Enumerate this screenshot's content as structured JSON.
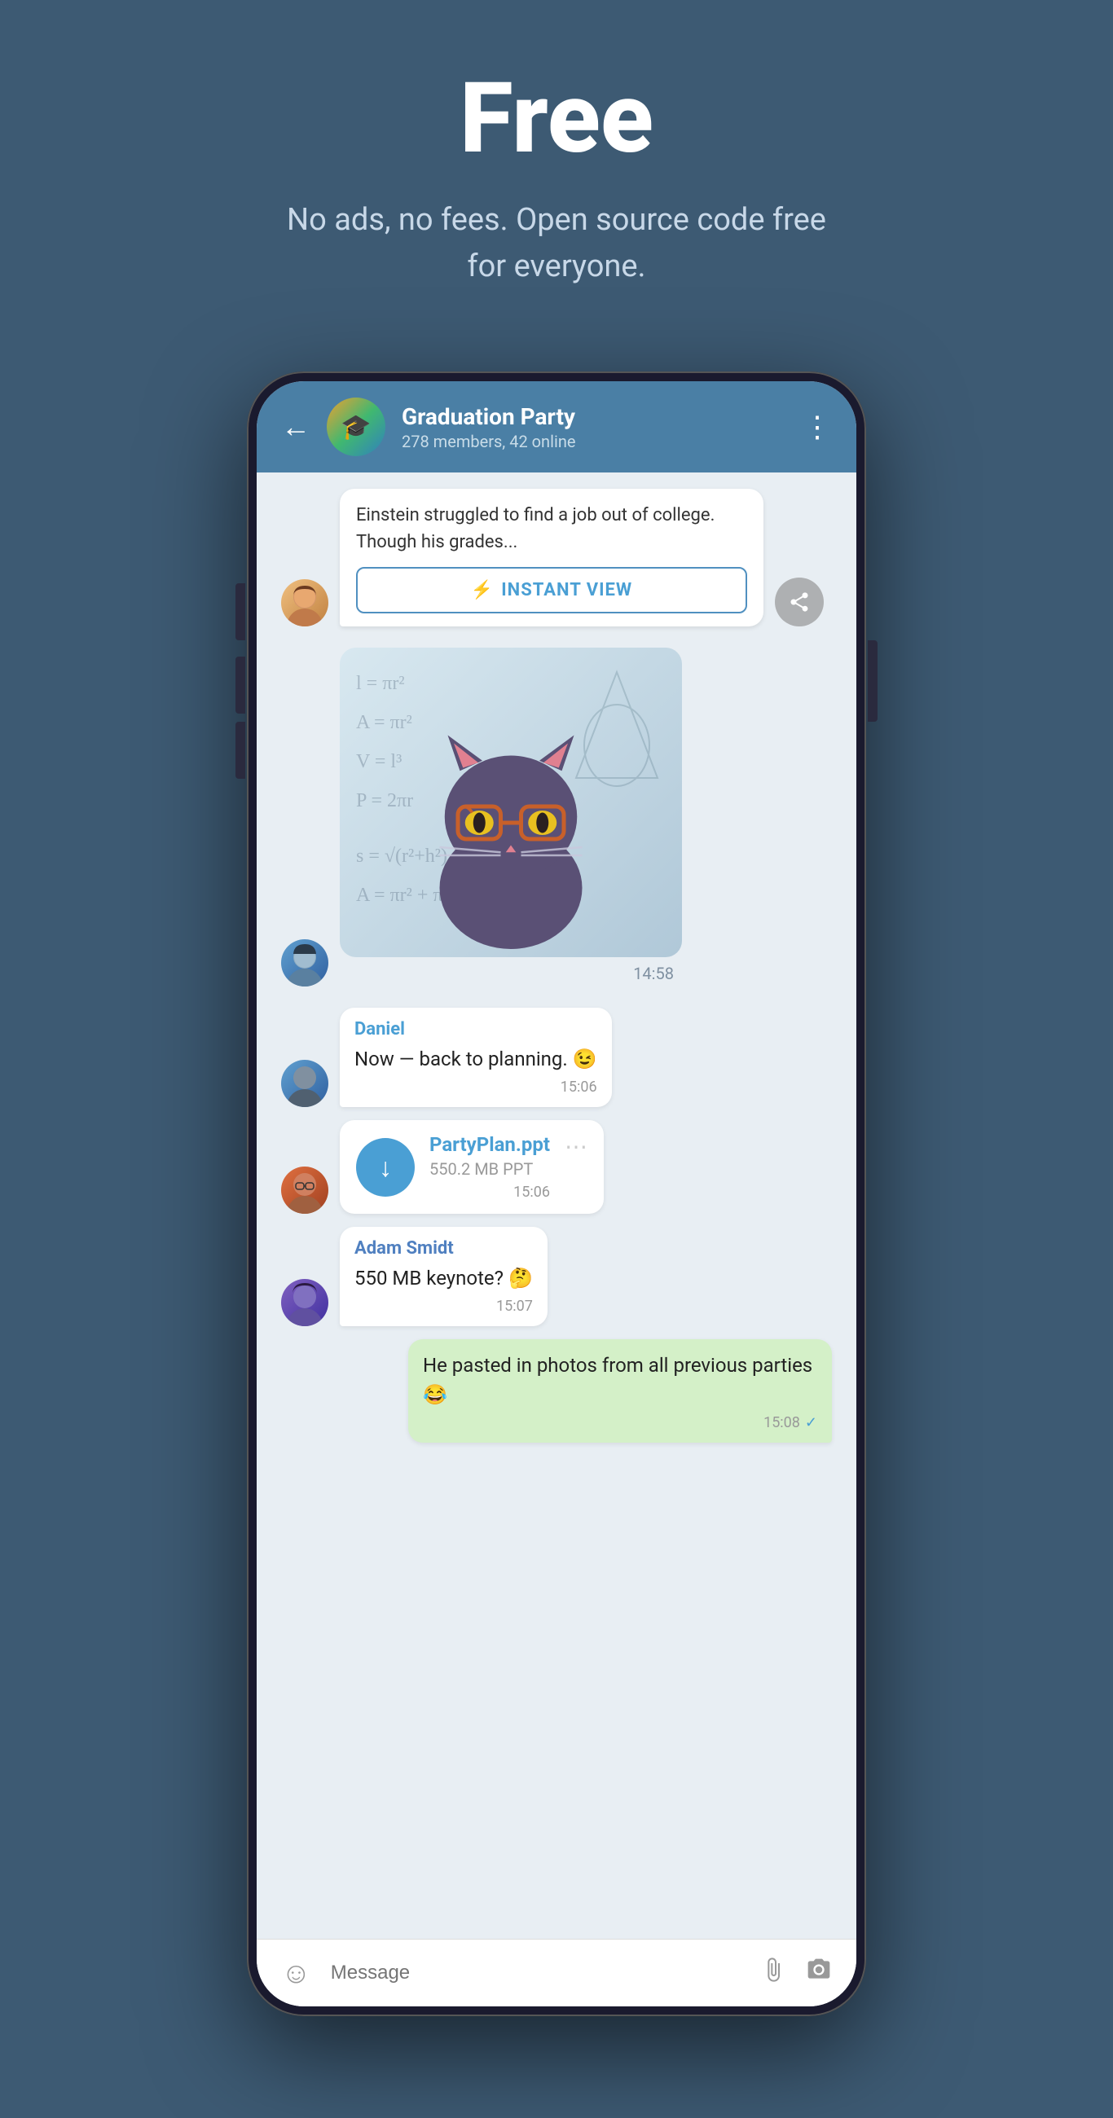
{
  "page": {
    "background_color": "#3d5a73"
  },
  "hero": {
    "title": "Free",
    "subtitle": "No ads, no fees. Open source code free for everyone."
  },
  "chat_header": {
    "back_label": "←",
    "group_name": "Graduation Party",
    "group_info": "278 members, 42 online",
    "more_icon": "⋮"
  },
  "messages": [
    {
      "id": "iv_message",
      "type": "instant_view",
      "text": "Einstein struggled to find a job out of college. Though his grades...",
      "button_label": "INSTANT VIEW",
      "time": ""
    },
    {
      "id": "sticker",
      "type": "sticker",
      "time": "14:58"
    },
    {
      "id": "daniel_msg",
      "type": "incoming",
      "sender": "Daniel",
      "text": "Now — back to planning. 😉",
      "time": "15:06"
    },
    {
      "id": "file_msg",
      "type": "file",
      "filename": "PartyPlan.ppt",
      "filesize": "550.2 MB PPT",
      "time": "15:06"
    },
    {
      "id": "adam_msg",
      "type": "incoming",
      "sender": "Adam Smidt",
      "sender_color": "adam",
      "text": "550 MB keynote? 🤔",
      "time": "15:07"
    },
    {
      "id": "outgoing_msg",
      "type": "outgoing",
      "text": "He pasted in photos from all previous parties 😂",
      "time": "15:08",
      "read": true
    }
  ],
  "input_bar": {
    "placeholder": "Message",
    "emoji_icon": "☺",
    "attach_icon": "🖇",
    "camera_icon": "⊙"
  },
  "math_formulas": [
    "l = πr²",
    "A = πr²",
    "V = l³",
    "P = 2πr",
    "A = πr²",
    "s = √(r²+h²)",
    "A = πr² + πrs"
  ]
}
